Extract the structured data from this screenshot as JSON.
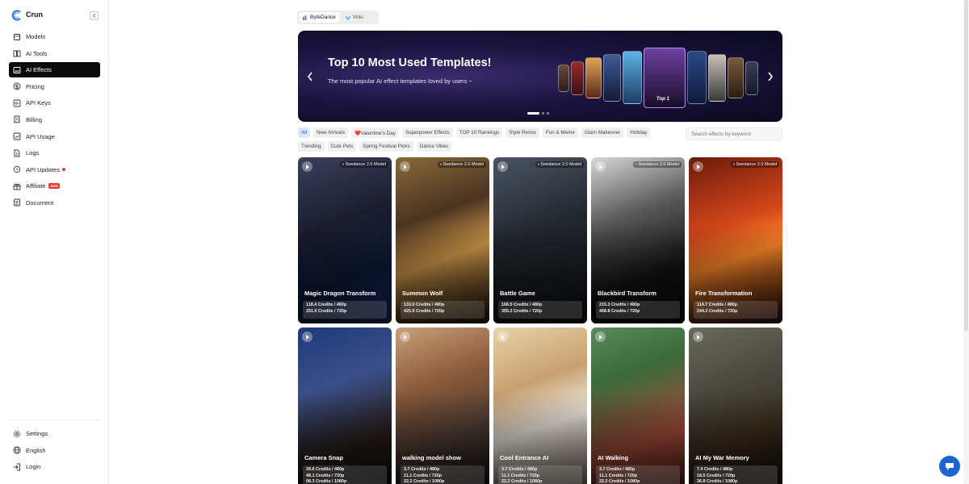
{
  "app": {
    "name": "Crun"
  },
  "sidebar": {
    "items": [
      {
        "label": "Models",
        "icon": "cube-icon"
      },
      {
        "label": "AI Tools",
        "icon": "book-icon"
      },
      {
        "label": "AI Effects",
        "icon": "sparkle-image-icon",
        "active": true
      },
      {
        "label": "Pricing",
        "icon": "dollar-icon"
      },
      {
        "label": "API Keys",
        "icon": "key-icon"
      },
      {
        "label": "Billing",
        "icon": "receipt-icon"
      },
      {
        "label": "API Usage",
        "icon": "chart-icon"
      },
      {
        "label": "Logs",
        "icon": "document-icon"
      },
      {
        "label": "API Updates",
        "icon": "update-icon",
        "dot": true
      },
      {
        "label": "Affiliate",
        "icon": "gift-icon",
        "badge": "NEW"
      },
      {
        "label": "Document",
        "icon": "file-icon"
      }
    ],
    "bottom": [
      {
        "label": "Settings",
        "icon": "gear-icon"
      },
      {
        "label": "English",
        "icon": "globe-icon"
      },
      {
        "label": "Login",
        "icon": "login-icon"
      }
    ]
  },
  "provider_tabs": [
    {
      "label": "ByteDance",
      "active": true
    },
    {
      "label": "Vidu",
      "active": false
    }
  ],
  "banner": {
    "title": "Top 10 Most Used Templates!",
    "subtitle": "The most popular AI effect templates loved by users ~",
    "top_label": "Top 1"
  },
  "filters": {
    "row1": [
      "All",
      "New Arrivals",
      "❤️Valentine's Day",
      "Superpower Effects",
      "TOP 10 Rankings",
      "Style Remix",
      "Fun & Meme",
      "Glam Makeover",
      "Holiday"
    ],
    "row2": [
      "Trending",
      "Cute Pets",
      "Spring Festival Picks",
      "Dance Vibes"
    ],
    "active": "All"
  },
  "search": {
    "placeholder": "Search effects by keyword"
  },
  "cards": [
    {
      "title": "Magic Dragon Transform",
      "model": "Seedance 2.0 Model",
      "prices": [
        "118.4 Credits / 480p",
        "251.6 Credits / 720p"
      ]
    },
    {
      "title": "Summon Wolf",
      "model": "Seedance 2.0 Model",
      "prices": [
        "133.0 Credits / 480p",
        "425.5 Credits / 720p"
      ]
    },
    {
      "title": "Battle Game",
      "model": "Seedance 2.0 Model",
      "prices": [
        "166.5 Credits / 480p",
        "355.2 Credits / 720p"
      ]
    },
    {
      "title": "Blackbird Transform",
      "model": "Seedance 2.0 Model",
      "prices": [
        "215.3 Credits / 480p",
        "468.8 Credits / 720p"
      ]
    },
    {
      "title": "Fire Transformation",
      "model": "Seedance 2.0 Model",
      "prices": [
        "114.7 Credits / 480p",
        "244.2 Credits / 720p"
      ]
    },
    {
      "title": "Camera Snap",
      "prices": [
        "29.6 Credits / 480p",
        "48.1 Credits / 720p",
        "98.3 Credits / 1080p"
      ]
    },
    {
      "title": "walking model show",
      "prices": [
        "3.7 Credits / 480p",
        "11.1 Credits / 720p",
        "22.2 Credits / 1080p"
      ]
    },
    {
      "title": "Cool Entrance AI",
      "prices": [
        "3.7 Credits / 480p",
        "11.1 Credits / 720p",
        "22.2 Credits / 1080p"
      ]
    },
    {
      "title": "AI Walking",
      "prices": [
        "3.7 Credits / 480p",
        "11.1 Credits / 720p",
        "22.2 Credits / 1080p"
      ]
    },
    {
      "title": "AI My War Memory",
      "prices": [
        "7.4 Credits / 480p",
        "18.5 Credits / 720p",
        "36.8 Credits / 1080p"
      ]
    }
  ],
  "colors": {
    "accent": "#1e63d6",
    "active_nav": "#0b0b0b",
    "badge": "#e53935"
  }
}
